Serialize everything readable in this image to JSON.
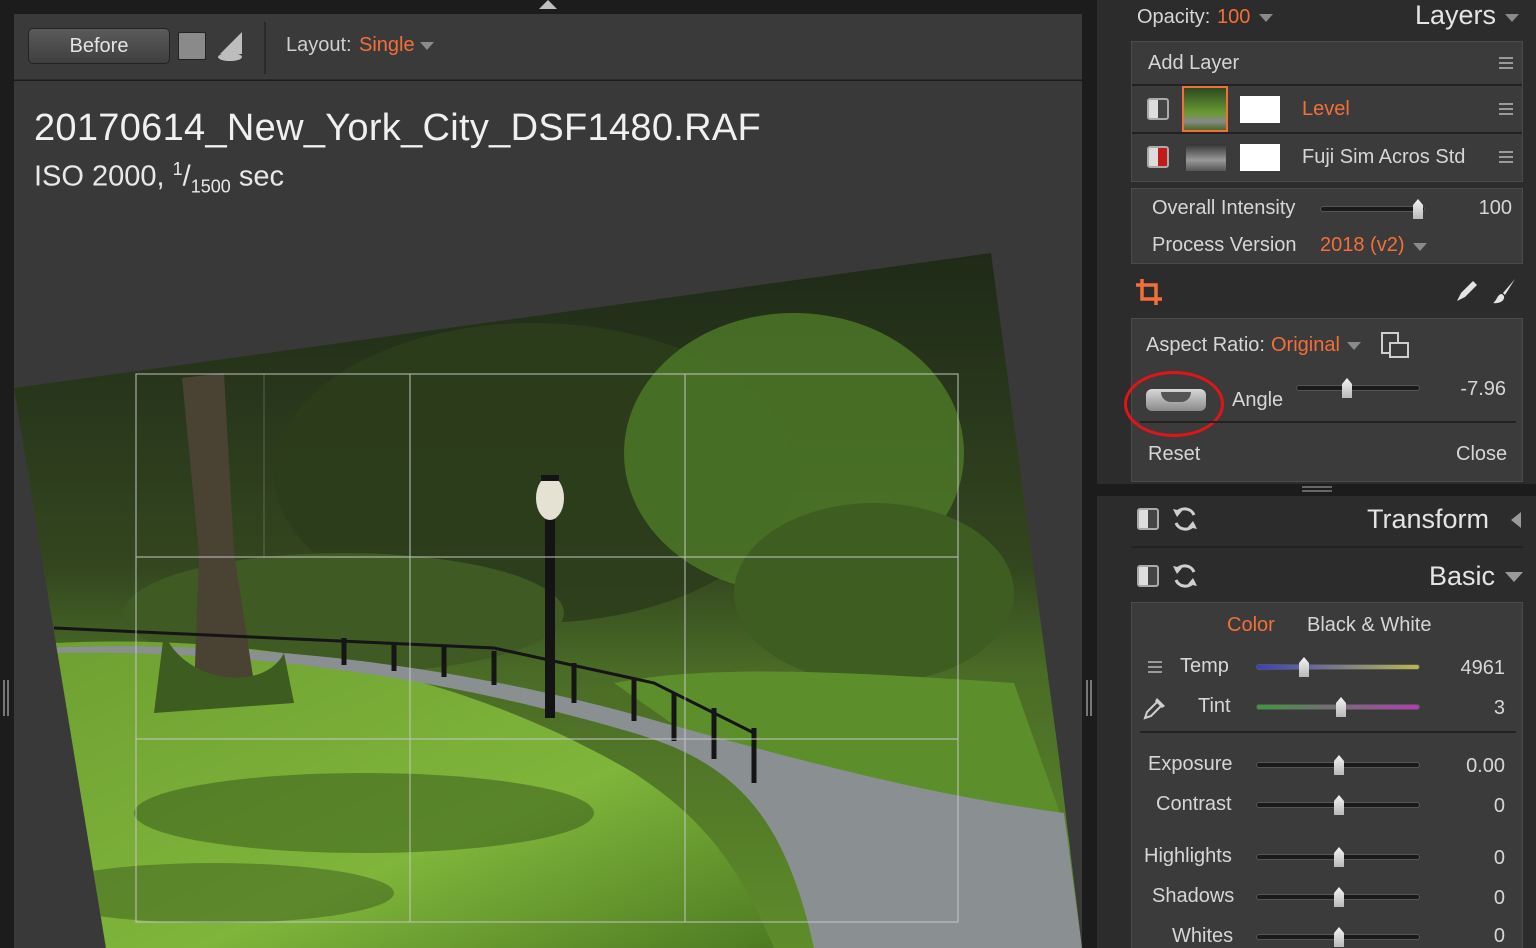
{
  "toolbar": {
    "before_label": "Before",
    "layout_label": "Layout:",
    "layout_value": "Single"
  },
  "image": {
    "file_name": "20170614_New_York_City_DSF1480.RAF",
    "iso": "ISO 2000,",
    "shutter_num": "1",
    "shutter_den": "1500",
    "shutter_unit": "sec"
  },
  "layers": {
    "opacity_label": "Opacity:",
    "opacity_value": "100",
    "panel_title": "Layers",
    "add_layer_label": "Add Layer",
    "items": [
      {
        "name": "Level",
        "selected": true
      },
      {
        "name": "Fuji Sim Acros Std",
        "selected": false
      }
    ],
    "overall_intensity_label": "Overall Intensity",
    "overall_intensity_value": "100",
    "process_version_label": "Process Version",
    "process_version_value": "2018 (v2)"
  },
  "crop": {
    "aspect_ratio_label": "Aspect Ratio:",
    "aspect_ratio_value": "Original",
    "angle_label": "Angle",
    "angle_value": "-7.96",
    "reset_label": "Reset",
    "close_label": "Close"
  },
  "sections": {
    "transform_title": "Transform",
    "basic_title": "Basic"
  },
  "basic": {
    "tab_color": "Color",
    "tab_bw": "Black & White",
    "temp_label": "Temp",
    "temp_value": "4961",
    "tint_label": "Tint",
    "tint_value": "3",
    "exposure_label": "Exposure",
    "exposure_value": "0.00",
    "contrast_label": "Contrast",
    "contrast_value": "0",
    "highlights_label": "Highlights",
    "highlights_value": "0",
    "shadows_label": "Shadows",
    "shadows_value": "0",
    "whites_label": "Whites",
    "whites_value": "0"
  },
  "icons": {
    "crop": "crop-icon",
    "pencil": "pencil-icon",
    "brush": "brush-icon",
    "reset": "reset-icon",
    "eyedropper": "eyedropper-icon",
    "rotate_aspect": "rotate-aspect-icon",
    "level_tool": "level-tool-icon"
  },
  "colors": {
    "accent": "#f26f3a",
    "annotation": "#e0141b"
  }
}
